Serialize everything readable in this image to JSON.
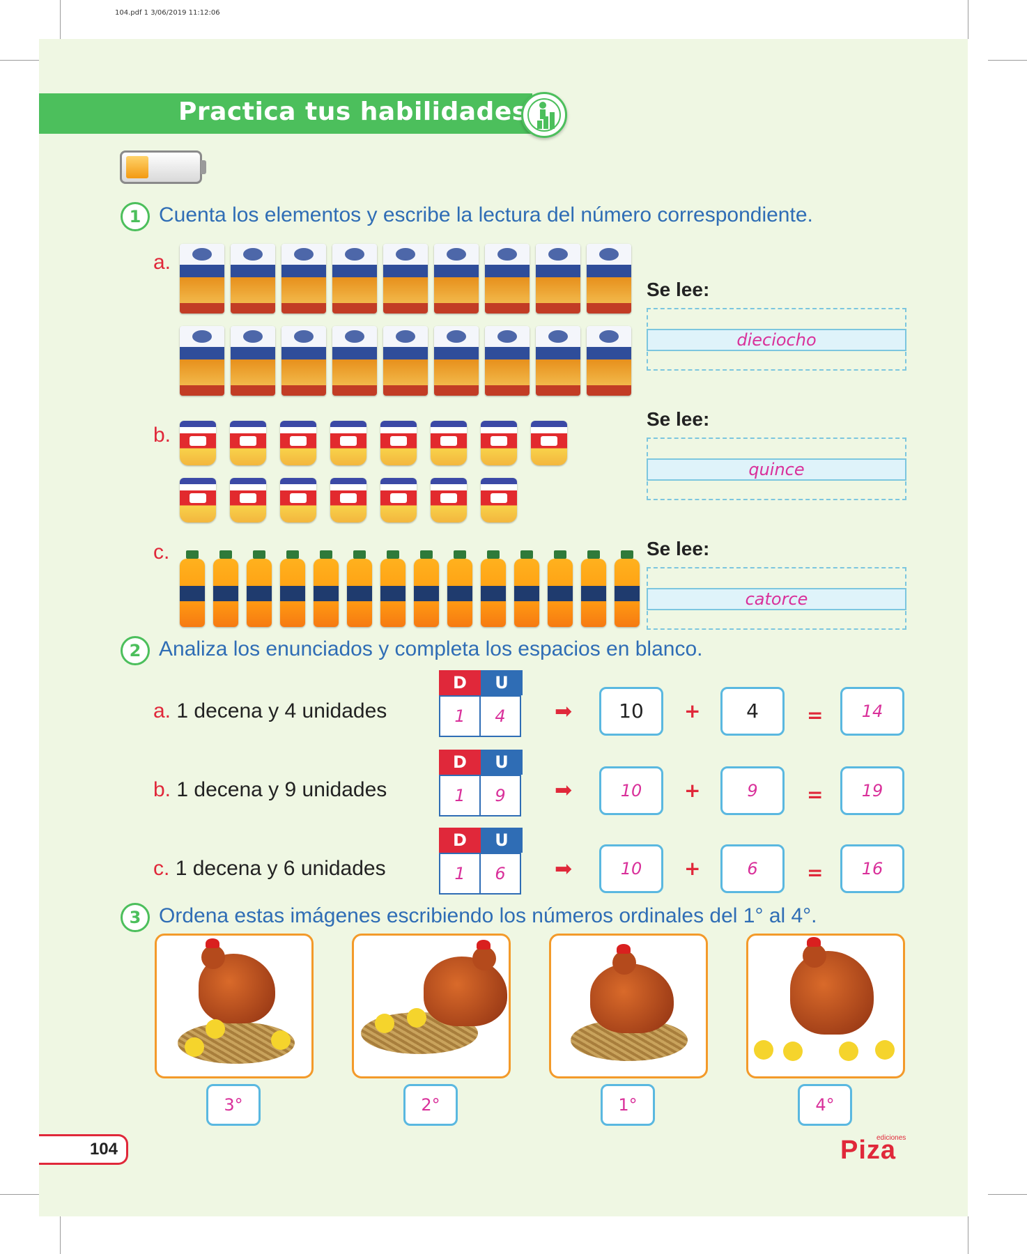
{
  "file_header": "104.pdf  1  3/06/2019  11:12:06",
  "banner": {
    "title": "Practica tus habilidades",
    "badge_icon": "progress-stairs-icon"
  },
  "questions": [
    {
      "number": "1",
      "text": "Cuenta los elementos y escribe la lectura del número correspondiente."
    },
    {
      "number": "2",
      "text": "Analiza los enunciados y completa los espacios en blanco."
    },
    {
      "number": "3",
      "text": "Ordena estas imágenes escribiendo los números ordinales del 1° al 4°."
    }
  ],
  "q1": {
    "items": [
      {
        "letter": "a.",
        "image_count": 18,
        "label": "Se lee:",
        "answer": "dieciocho",
        "product": "Blanca Flor flour bags"
      },
      {
        "letter": "b.",
        "image_count": 15,
        "label": "Se lee:",
        "answer": "quince",
        "product": "Gloria yogurt cups"
      },
      {
        "letter": "c.",
        "image_count": 14,
        "label": "Se lee:",
        "answer": "catorce",
        "product": "juice bottles"
      }
    ]
  },
  "q2": {
    "rows": [
      {
        "letter": "a.",
        "statement": "1 decena y 4 unidades",
        "d_head": "D",
        "u_head": "U",
        "d": "1",
        "u": "4",
        "tens": "10",
        "units": "4",
        "sum": "14"
      },
      {
        "letter": "b.",
        "statement": "1 decena y 9 unidades",
        "d_head": "D",
        "u_head": "U",
        "d": "1",
        "u": "9",
        "tens": "10",
        "units": "9",
        "sum": "19"
      },
      {
        "letter": "c.",
        "statement": "1 decena y 6 unidades",
        "d_head": "D",
        "u_head": "U",
        "d": "1",
        "u": "6",
        "tens": "10",
        "units": "6",
        "sum": "16"
      }
    ],
    "arrow": "➡",
    "plus": "+",
    "equals": "="
  },
  "q3": {
    "ordinals": [
      "3°",
      "2°",
      "1°",
      "4°"
    ]
  },
  "footer": {
    "page_number": "104",
    "publisher_small": "ediciones",
    "publisher": "Piza"
  },
  "colors": {
    "page_bg": "#eff7e3",
    "banner": "#4cbf5c",
    "question_text": "#2f6db5",
    "letter": "#e0283a",
    "answer": "#d9309a",
    "box_border": "#5ab8e0",
    "frame_border": "#f39a2a"
  }
}
